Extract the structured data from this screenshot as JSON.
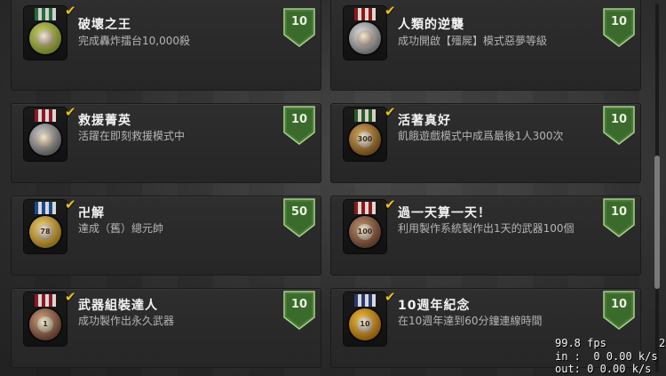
{
  "achievements": [
    {
      "title": "破壞之王",
      "desc": "完成轟炸擂台10,000殺",
      "points": "10",
      "completed": true,
      "icon": "grenade-launcher-medal-icon",
      "ribbon": [
        "#2a6a3a",
        "#d0d0d0"
      ],
      "disc": [
        "#c8d06a",
        "#6f7a2a"
      ],
      "disc_text": ""
    },
    {
      "title": "人類的逆襲",
      "desc": "成功開啟【殭屍】模式惡夢等級",
      "points": "10",
      "completed": true,
      "icon": "skull-medal-icon",
      "ribbon": [
        "#8a1a1a",
        "#e0d8d0"
      ],
      "disc": [
        "#e0e0e0",
        "#6a6a6a"
      ],
      "disc_text": ""
    },
    {
      "title": "救援菁英",
      "desc": "活躍在即刻救援模式中",
      "points": "10",
      "completed": true,
      "icon": "rescue-medal-icon",
      "ribbon": [
        "#8a1a2a",
        "#e0d8d0"
      ],
      "disc": [
        "#cfcfcf",
        "#5a5a5a"
      ],
      "disc_text": ""
    },
    {
      "title": "活著真好",
      "desc": "飢餓遊戲模式中成爲最後1人300次",
      "points": "10",
      "completed": true,
      "icon": "survivor-medal-icon",
      "ribbon": [
        "#2a5a2a",
        "#d8d0c0"
      ],
      "disc": [
        "#d8a860",
        "#6a4a1a"
      ],
      "disc_text": "300"
    },
    {
      "title": "卍解",
      "desc": "達成（舊）總元帥",
      "points": "50",
      "completed": true,
      "icon": "star-medal-icon",
      "ribbon": [
        "#1a4a8a",
        "#d8d8d8"
      ],
      "disc": [
        "#f0d070",
        "#8a6a1a"
      ],
      "disc_text": "78"
    },
    {
      "title": "過一天算一天！",
      "desc": "利用製作系統製作出1天的武器100個",
      "points": "10",
      "completed": true,
      "icon": "gear-medal-icon",
      "ribbon": [
        "#8a1a1a",
        "#e0d8d0"
      ],
      "disc": [
        "#c09070",
        "#5a3a2a"
      ],
      "disc_text": "100"
    },
    {
      "title": "武器組裝達人",
      "desc": "成功製作出永久武器",
      "points": "10",
      "completed": true,
      "icon": "craft-medal-icon",
      "ribbon": [
        "#8a1a2a",
        "#e0d8d0"
      ],
      "disc": [
        "#d0a080",
        "#5a3a2a"
      ],
      "disc_text": "1"
    },
    {
      "title": "10週年紀念",
      "desc": "在10週年達到60分鐘連線時間",
      "points": "10",
      "completed": true,
      "icon": "anniversary-medal-icon",
      "ribbon": [
        "#2a3a6a",
        "#d8d8e0"
      ],
      "disc": [
        "#f0c040",
        "#8a5a10"
      ],
      "disc_text": "10"
    }
  ],
  "checkmark": "✔",
  "stats": {
    "fps": "99.8 fps",
    "in": "in :  0 0.00 k/s",
    "out": "out: 0 0.00 k/s",
    "edge": "2"
  }
}
